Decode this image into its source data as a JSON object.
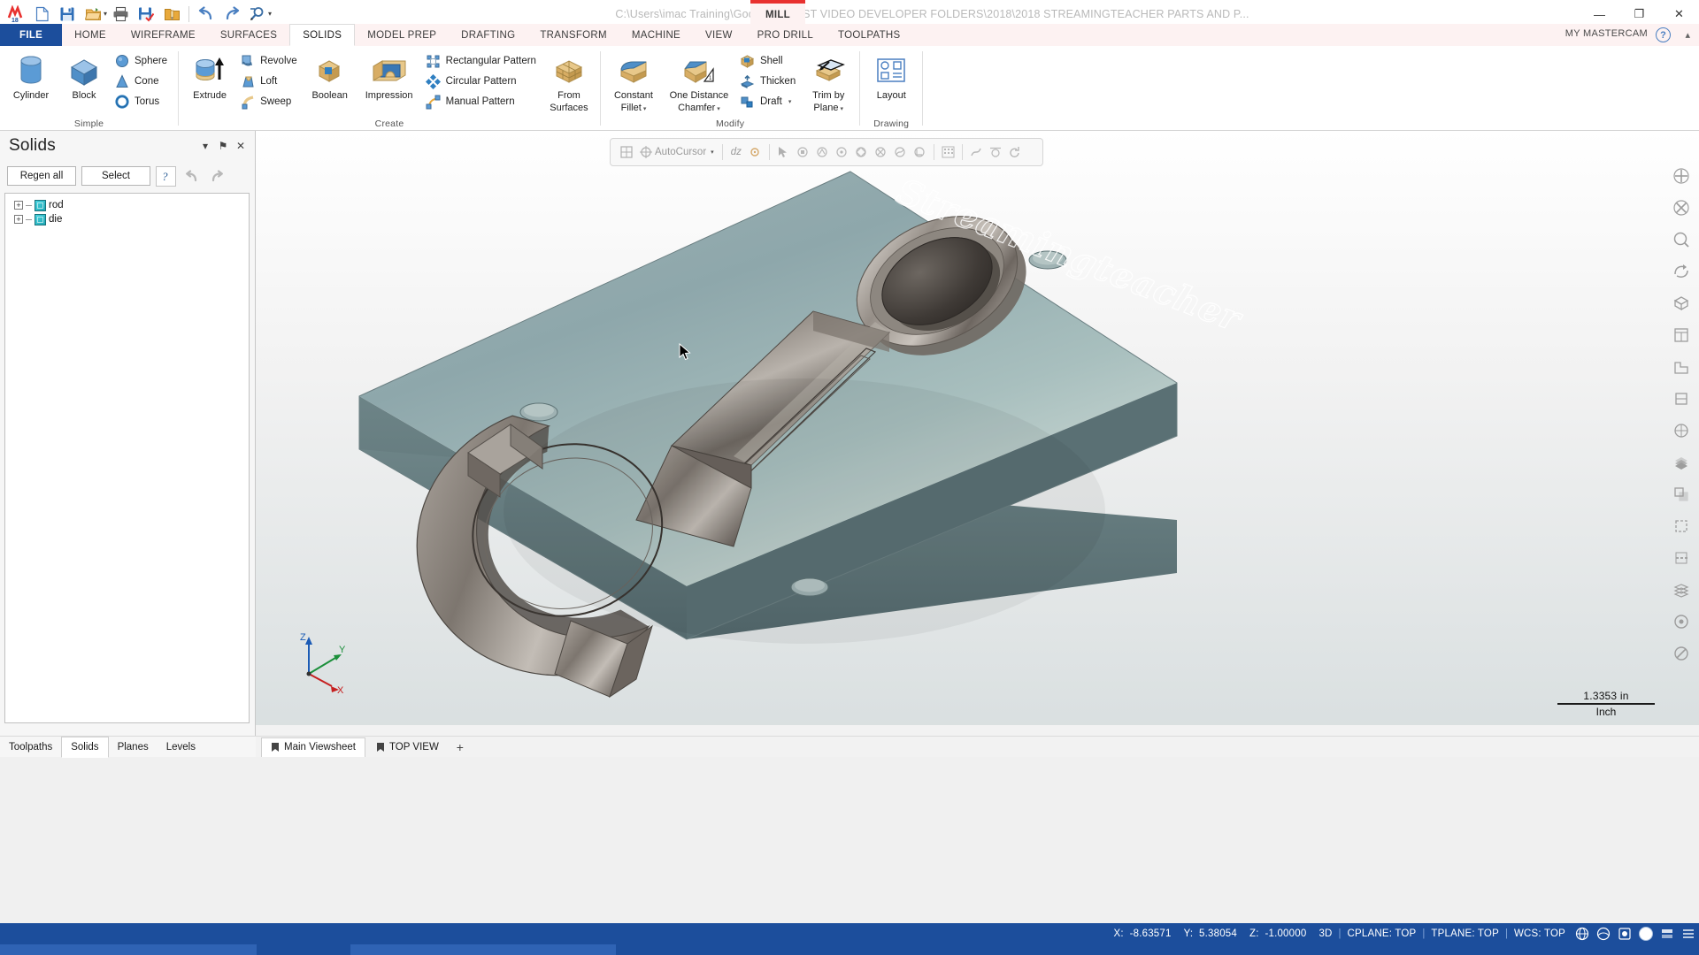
{
  "titlebar": {
    "path": "C:\\Users\\imac Training\\Google Drive\\ST VIDEO DEVELOPER FOLDERS\\2018\\2018 STREAMINGTEACHER PARTS AND P...",
    "machine_tab": "MILL",
    "accent_red": "#e8312f",
    "quick_access": [
      {
        "name": "new-file-icon",
        "glyph": "new"
      },
      {
        "name": "save-icon",
        "glyph": "save"
      },
      {
        "name": "open-folder-icon",
        "glyph": "open"
      },
      {
        "name": "print-icon",
        "glyph": "print"
      },
      {
        "name": "save-some-icon",
        "glyph": "savesome"
      },
      {
        "name": "zip-folder-icon",
        "glyph": "zip"
      },
      {
        "name": "undo-icon",
        "glyph": "undo"
      },
      {
        "name": "redo-icon",
        "glyph": "redo"
      },
      {
        "name": "analyze-icon",
        "glyph": "analyze"
      }
    ],
    "window_controls": {
      "minimize": "—",
      "maximize": "❐",
      "close": "✕"
    }
  },
  "ribbon_tabs": [
    {
      "label": "FILE",
      "kind": "file"
    },
    {
      "label": "HOME",
      "kind": "normal"
    },
    {
      "label": "WIREFRAME",
      "kind": "normal"
    },
    {
      "label": "SURFACES",
      "kind": "normal"
    },
    {
      "label": "SOLIDS",
      "kind": "active"
    },
    {
      "label": "MODEL PREP",
      "kind": "normal"
    },
    {
      "label": "DRAFTING",
      "kind": "normal"
    },
    {
      "label": "TRANSFORM",
      "kind": "normal"
    },
    {
      "label": "MACHINE",
      "kind": "normal"
    },
    {
      "label": "VIEW",
      "kind": "normal"
    },
    {
      "label": "PRO DRILL",
      "kind": "normal"
    },
    {
      "label": "TOOLPATHS",
      "kind": "normal"
    }
  ],
  "ribbon_right": {
    "account": "MY MASTERCAM",
    "help": "?",
    "collapse": "▴"
  },
  "ribbon_groups": {
    "simple": {
      "label": "Simple",
      "big": [
        {
          "label": "Cylinder",
          "icon": "cylinder-icon"
        },
        {
          "label": "Block",
          "icon": "block-icon"
        }
      ],
      "small": [
        {
          "label": "Sphere",
          "icon": "sphere-icon"
        },
        {
          "label": "Cone",
          "icon": "cone-icon"
        },
        {
          "label": "Torus",
          "icon": "torus-icon"
        }
      ]
    },
    "create": {
      "label": "Create",
      "extrude": {
        "label": "Extrude",
        "icon": "extrude-icon"
      },
      "small1": [
        {
          "label": "Revolve",
          "icon": "revolve-icon"
        },
        {
          "label": "Loft",
          "icon": "loft-icon"
        },
        {
          "label": "Sweep",
          "icon": "sweep-icon"
        }
      ],
      "boolean": {
        "label": "Boolean",
        "icon": "boolean-icon"
      },
      "impression": {
        "label": "Impression",
        "icon": "impression-icon"
      },
      "small2": [
        {
          "label": "Rectangular Pattern",
          "icon": "rectangular-pattern-icon"
        },
        {
          "label": "Circular Pattern",
          "icon": "circular-pattern-icon"
        },
        {
          "label": "Manual Pattern",
          "icon": "manual-pattern-icon"
        }
      ],
      "from_surfaces": {
        "label1": "From",
        "label2": "Surfaces",
        "icon": "from-surfaces-icon"
      }
    },
    "modify": {
      "label": "Modify",
      "constant_fillet": {
        "label1": "Constant",
        "label2": "Fillet",
        "icon": "constant-fillet-icon",
        "dropdown": true
      },
      "one_distance_chamfer": {
        "label1": "One Distance",
        "label2": "Chamfer",
        "icon": "one-distance-chamfer-icon",
        "dropdown": true
      },
      "small": [
        {
          "label": "Shell",
          "icon": "shell-icon",
          "dropdown": false
        },
        {
          "label": "Thicken",
          "icon": "thicken-icon",
          "dropdown": false
        },
        {
          "label": "Draft",
          "icon": "draft-icon",
          "dropdown": true
        }
      ],
      "trim_by_plane": {
        "label1": "Trim by",
        "label2": "Plane",
        "icon": "trim-by-plane-icon",
        "dropdown": true
      }
    },
    "drawing": {
      "label": "Drawing",
      "layout": {
        "label": "Layout",
        "icon": "layout-icon"
      }
    }
  },
  "solids_panel": {
    "title": "Solids",
    "header_icons": [
      {
        "name": "panel-dropdown-icon",
        "glyph": "▾"
      },
      {
        "name": "panel-pin-icon",
        "glyph": "⚑"
      },
      {
        "name": "panel-close-icon",
        "glyph": "✕"
      }
    ],
    "buttons": {
      "regen_all": "Regen all",
      "select": "Select"
    },
    "tool_icons": [
      {
        "name": "help-question-icon",
        "glyph": "?"
      },
      {
        "name": "undo-icon",
        "glyph": "↶"
      },
      {
        "name": "redo-icon",
        "glyph": "↷"
      }
    ],
    "tree": [
      {
        "label": "rod",
        "icon": "solid-body-icon",
        "expandable": true
      },
      {
        "label": "die",
        "icon": "solid-body-icon",
        "expandable": true
      }
    ]
  },
  "bottom_left_tabs": [
    {
      "label": "Toolpaths",
      "active": false
    },
    {
      "label": "Solids",
      "active": true
    },
    {
      "label": "Planes",
      "active": false
    },
    {
      "label": "Levels",
      "active": false
    }
  ],
  "viewport": {
    "watermark": "Streamingteacher",
    "autocursor": {
      "label": "AutoCursor",
      "delta_label": "dz",
      "icons": [
        {
          "name": "autocursor-grid-icon"
        },
        {
          "name": "autocursor-target-icon"
        },
        {
          "name": "autocursor-caret-icon"
        },
        {
          "name": "autocursor-origin-icon"
        },
        {
          "name": "snap-arrow-icon"
        },
        {
          "name": "snap-endpoint-icon"
        },
        {
          "name": "snap-midpoint-icon"
        },
        {
          "name": "snap-center-icon"
        },
        {
          "name": "snap-quadrant-icon"
        },
        {
          "name": "snap-intersection-icon"
        },
        {
          "name": "snap-nearest-icon"
        },
        {
          "name": "snap-perpendicular-icon"
        },
        {
          "name": "snap-tangent-icon"
        },
        {
          "name": "snap-point-icon"
        },
        {
          "name": "snap-relative-icon"
        },
        {
          "name": "snap-reset-icon"
        }
      ]
    },
    "right_toolbar": [
      {
        "name": "fit-screen-icon"
      },
      {
        "name": "unzoom-icon"
      },
      {
        "name": "zoom-window-icon"
      },
      {
        "name": "dynamic-rotate-icon"
      },
      {
        "name": "isometric-view-icon"
      },
      {
        "name": "top-view-icon"
      },
      {
        "name": "front-view-icon"
      },
      {
        "name": "right-view-icon"
      },
      {
        "name": "wireframe-shading-icon"
      },
      {
        "name": "shaded-icon"
      },
      {
        "name": "translucency-icon"
      },
      {
        "name": "wireframe-icon"
      },
      {
        "name": "hidden-lines-icon"
      },
      {
        "name": "levels-icon"
      },
      {
        "name": "blank-entity-icon"
      },
      {
        "name": "unblank-icon"
      }
    ],
    "scale": {
      "value": "1.3353 in",
      "unit": "Inch"
    },
    "gnomon": {
      "z": "Z",
      "y": "Y",
      "x": "X"
    }
  },
  "viewsheets": {
    "tabs": [
      {
        "label": "Main Viewsheet",
        "active": true,
        "icon": "viewsheet-icon"
      },
      {
        "label": "TOP VIEW",
        "active": false,
        "icon": "viewsheet-icon"
      }
    ],
    "add": "+"
  },
  "statusbar": {
    "coords": [
      {
        "label": "X:",
        "value": "-8.63571"
      },
      {
        "label": "Y:",
        "value": "5.38054"
      },
      {
        "label": "Z:",
        "value": "-1.00000"
      }
    ],
    "mode": "3D",
    "planes": [
      {
        "label": "CPLANE: TOP"
      },
      {
        "label": "TPLANE: TOP"
      },
      {
        "label": "WCS: TOP"
      }
    ],
    "icons": [
      {
        "name": "globe-wcs-icon"
      },
      {
        "name": "globe-cplane-icon"
      },
      {
        "name": "2d3d-toggle-icon"
      },
      {
        "name": "color-swatch-icon"
      },
      {
        "name": "level-swatch-icon"
      },
      {
        "name": "attributes-icon"
      }
    ],
    "bg_color": "#1c4e9c"
  }
}
